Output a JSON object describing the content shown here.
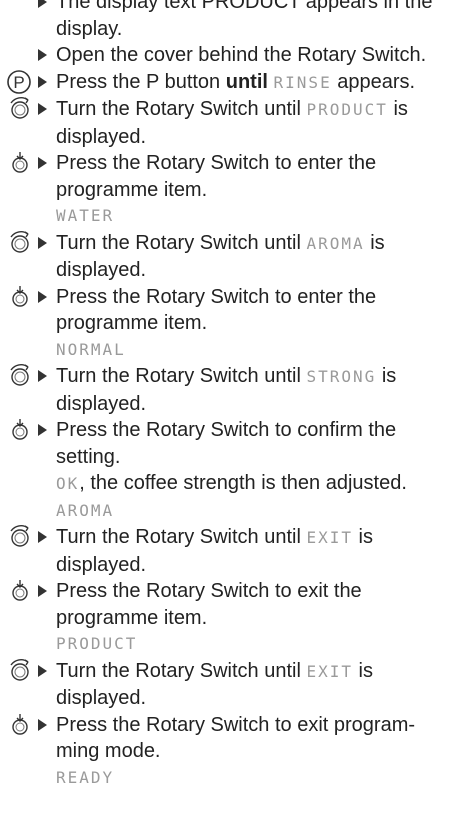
{
  "steps": [
    {
      "icon": "none",
      "text": "The display text PRODUCT appears in the display."
    },
    {
      "icon": "none",
      "text": "Open the cover behind the Rotary Switch."
    },
    {
      "icon": "p-button",
      "pre": "Press the P button ",
      "bold": "until",
      "disp": "RINSE",
      "post": " appears."
    },
    {
      "icon": "rotary-turn",
      "pre": "Turn the Rotary Switch until ",
      "disp": "PRODUCT",
      "post": " is displayed."
    },
    {
      "icon": "rotary-press",
      "text": "Press the Rotary Switch to enter the programme item.",
      "display_line": "WATER"
    },
    {
      "icon": "rotary-turn",
      "pre": "Turn the Rotary Switch until ",
      "disp": "AROMA",
      "post": " is displayed."
    },
    {
      "icon": "rotary-press",
      "text": "Press the Rotary Switch to enter the programme item.",
      "display_line": "NORMAL"
    },
    {
      "icon": "rotary-turn",
      "pre": "Turn the Rotary Switch until ",
      "disp": "STRONG",
      "post": " is displayed."
    },
    {
      "icon": "rotary-press",
      "text": "Press the Rotary Switch to confirm the setting.",
      "note_disp": "OK",
      "note_text": ", the coffee strength is then adjusted.",
      "display_line": "AROMA"
    },
    {
      "icon": "rotary-turn",
      "pre": "Turn the Rotary Switch until ",
      "disp": "EXIT",
      "post": " is displayed."
    },
    {
      "icon": "rotary-press",
      "text": "Press the Rotary Switch to exit the programme item.",
      "display_line": "PRODUCT"
    },
    {
      "icon": "rotary-turn",
      "pre": "Turn the Rotary Switch until ",
      "disp": "EXIT",
      "post": " is displayed."
    },
    {
      "icon": "rotary-press",
      "text": "Press the Rotary Switch to exit program-ming mode.",
      "display_line": "READY"
    }
  ]
}
